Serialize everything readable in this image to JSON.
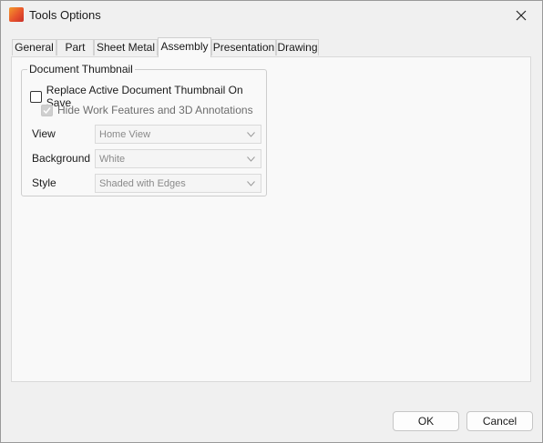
{
  "window": {
    "title": "Tools Options"
  },
  "tabs": [
    {
      "label": "General"
    },
    {
      "label": "Part"
    },
    {
      "label": "Sheet Metal"
    },
    {
      "label": "Assembly",
      "active": true
    },
    {
      "label": "Presentation"
    },
    {
      "label": "Drawing"
    }
  ],
  "document_thumbnail": {
    "group_label": "Document Thumbnail",
    "replace_checkbox": {
      "label": "Replace Active Document Thumbnail On Save",
      "checked": false
    },
    "hide_checkbox": {
      "label": "Hide Work Features and 3D Annotations",
      "checked": true,
      "disabled": true
    },
    "view": {
      "label": "View",
      "value": "Home View"
    },
    "background": {
      "label": "Background",
      "value": "White"
    },
    "style": {
      "label": "Style",
      "value": "Shaded with Edges"
    }
  },
  "buttons": {
    "ok": "OK",
    "cancel": "Cancel"
  },
  "icons": {
    "app": "app-logo-icon",
    "close": "close-icon",
    "dropdown": "chevron-down-icon",
    "check": "checkmark-icon"
  }
}
